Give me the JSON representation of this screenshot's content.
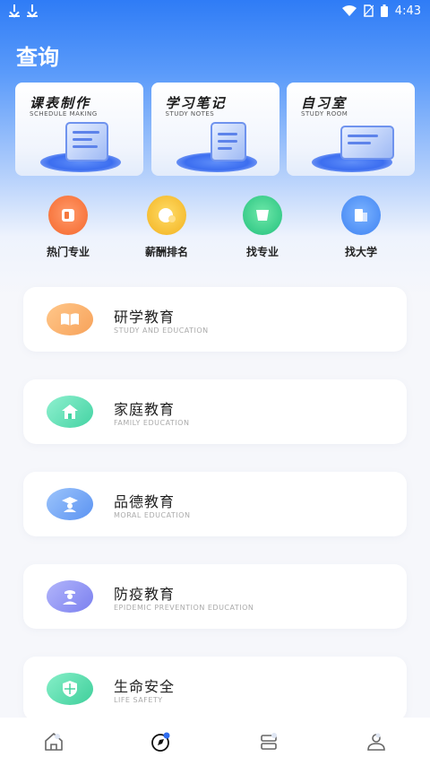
{
  "status_bar": {
    "time": "4:43"
  },
  "page": {
    "title": "查询"
  },
  "feature_cards": [
    {
      "title": "课表制作",
      "subtitle": "SCHEDULE MAKING"
    },
    {
      "title": "学习笔记",
      "subtitle": "STUDY NOTES"
    },
    {
      "title": "自习室",
      "subtitle": "STUDY ROOM"
    }
  ],
  "quick_links": [
    {
      "label": "热门专业",
      "icon": "book-icon",
      "color": "#f5793f"
    },
    {
      "label": "薪酬排名",
      "icon": "money-bag-icon",
      "color": "#f4c23a"
    },
    {
      "label": "找专业",
      "icon": "search-major-icon",
      "color": "#33cc88"
    },
    {
      "label": "找大学",
      "icon": "university-icon",
      "color": "#4b8ff7"
    }
  ],
  "education_items": [
    {
      "title": "研学教育",
      "subtitle": "STUDY AND EDUCATION",
      "icon": "open-book-icon",
      "color": "#fbb06d"
    },
    {
      "title": "家庭教育",
      "subtitle": "FAMILY EDUCATION",
      "icon": "house-icon",
      "color": "#5ee0b4"
    },
    {
      "title": "品德教育",
      "subtitle": "MORAL EDUCATION",
      "icon": "graduate-icon",
      "color": "#6fa5f7"
    },
    {
      "title": "防疫教育",
      "subtitle": "EPIDEMIC PREVENTION EDUCATION",
      "icon": "medical-staff-icon",
      "color": "#8f93f5"
    },
    {
      "title": "生命安全",
      "subtitle": "LIFE SAFETY",
      "icon": "shield-icon",
      "color": "#52d8a8"
    }
  ],
  "tabs": [
    {
      "name": "home-icon"
    },
    {
      "name": "compass-icon"
    },
    {
      "name": "layers-icon"
    },
    {
      "name": "profile-icon"
    }
  ]
}
